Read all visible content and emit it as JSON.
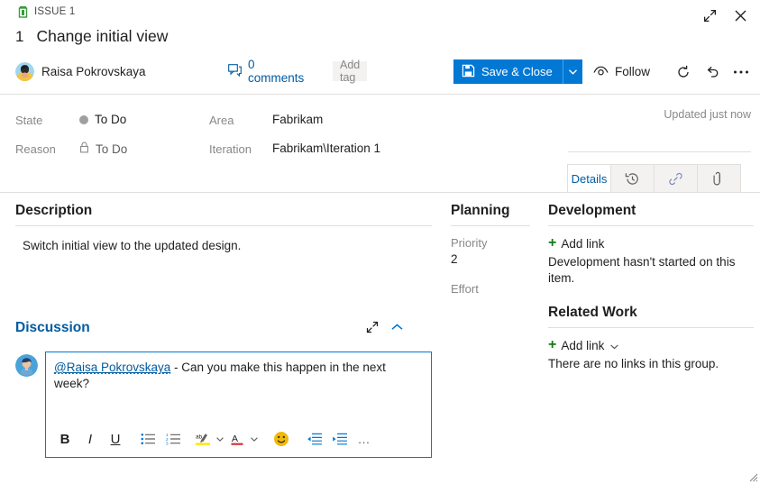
{
  "window": {
    "expand_title": "Expand",
    "close_title": "Close",
    "resize_grip": "resize-grip"
  },
  "header": {
    "issue_type_label": "ISSUE 1",
    "work_item_id": "1",
    "title": "Change initial view",
    "assignee": "Raisa Pokrovskaya",
    "comments_label": "0 comments",
    "add_tag_label": "Add tag",
    "save_label": "Save & Close",
    "follow_label": "Follow",
    "refresh_title": "Refresh",
    "undo_title": "Undo",
    "more_title": "More actions"
  },
  "fields": {
    "state_label": "State",
    "state_value": "To Do",
    "reason_label": "Reason",
    "reason_value": "To Do",
    "area_label": "Area",
    "area_value": "Fabrikam",
    "iteration_label": "Iteration",
    "iteration_value": "Fabrikam\\Iteration 1",
    "updated_note": "Updated just now"
  },
  "tabs": [
    {
      "label": "Details",
      "icon": "details",
      "active": true
    },
    {
      "label": "",
      "icon": "history-icon",
      "active": false
    },
    {
      "label": "",
      "icon": "link-icon",
      "active": false
    },
    {
      "label": "",
      "icon": "attachment-icon",
      "active": false
    }
  ],
  "description": {
    "heading": "Description",
    "text": "Switch initial view to the updated design."
  },
  "discussion": {
    "heading": "Discussion",
    "mention": "@Raisa Pokrovskaya",
    "comment_rest": " - Can you make this happen in the next week?",
    "toolbar": {
      "bold": "B",
      "italic": "I",
      "underline": "U",
      "bullet_list": "bulleted-list-icon",
      "numbered_list": "numbered-list-icon",
      "highlight": "highlight-icon",
      "font_color": "A",
      "emoji": "🙂",
      "outdent": "outdent-icon",
      "indent": "indent-icon",
      "more": "…"
    }
  },
  "planning": {
    "heading": "Planning",
    "priority_label": "Priority",
    "priority_value": "2",
    "effort_label": "Effort",
    "effort_value": ""
  },
  "development": {
    "heading": "Development",
    "add_link_label": "Add link",
    "empty_note": "Development hasn't started on this item."
  },
  "related_work": {
    "heading": "Related Work",
    "add_link_label": "Add link",
    "empty_note": "There are no links in this group."
  },
  "colors": {
    "accent": "#3a9a3a",
    "primary": "#0078d4",
    "link": "#005ba1",
    "muted": "#8a8886",
    "green_plus": "#107c10"
  }
}
